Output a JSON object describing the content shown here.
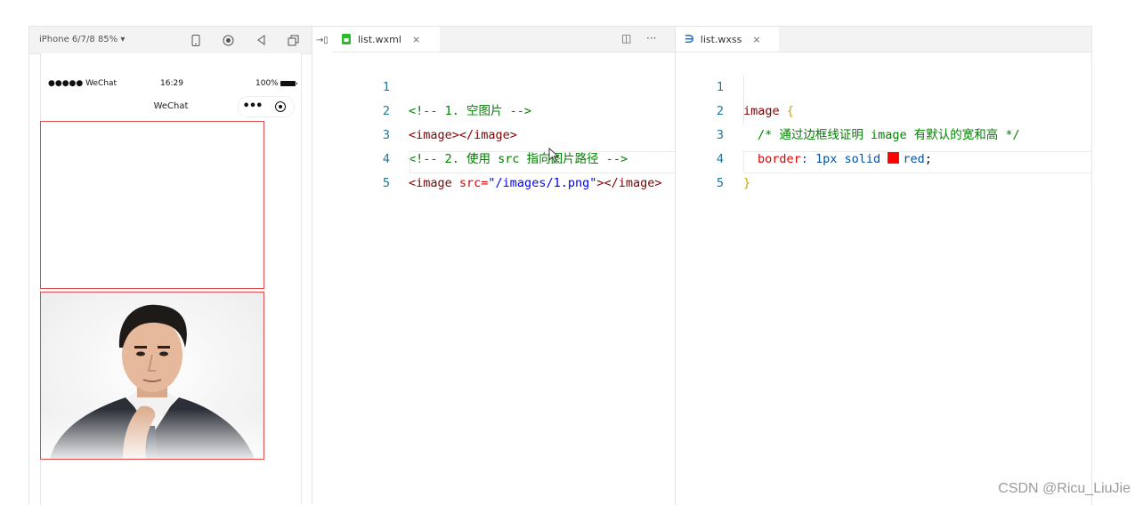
{
  "simulator": {
    "device": "iPhone 6/7/8 85% ▾",
    "status": {
      "carrier": "●●●●● WeChat",
      "time": "16:29",
      "battery": "100%"
    },
    "nav_title": "WeChat",
    "capsule_more": "•••",
    "images": [
      {
        "label": "empty image (no src)",
        "border_color": "#e04a4a"
      },
      {
        "label": "/images/1.png portrait",
        "border_color": "#e04a4a"
      }
    ]
  },
  "editor_left": {
    "tab": {
      "icon": "wxml-file-icon",
      "label": "list.wxml",
      "close": "×"
    },
    "actions": {
      "split": "◫",
      "more": "···"
    },
    "lines": [
      {
        "n": "1",
        "tokens": [
          "<!-- 1. 空图片 -->"
        ]
      },
      {
        "n": "2",
        "tokens": [
          "<image></image>"
        ]
      },
      {
        "n": "3",
        "tokens": [
          "<!-- 2. 使用 src 指向图片路径 -->"
        ]
      },
      {
        "n": "4",
        "tokens": [
          "<image",
          " src=",
          "\"/images/1.png\"",
          "></image>"
        ]
      },
      {
        "n": "5",
        "tokens": [
          ""
        ]
      }
    ]
  },
  "editor_right": {
    "tab": {
      "icon": "wxss-file-icon",
      "label": "list.wxss",
      "close": "×"
    },
    "lines": [
      {
        "n": "1",
        "tokens": [
          "image",
          " {"
        ]
      },
      {
        "n": "2",
        "tokens": [
          "/* 通过边框线证明 image 有默认的宽和高 */"
        ]
      },
      {
        "n": "3",
        "tokens": [
          "border",
          ": 1px solid ",
          "red",
          ";"
        ]
      },
      {
        "n": "4",
        "tokens": [
          "}"
        ]
      },
      {
        "n": "5",
        "tokens": [
          ""
        ]
      }
    ]
  },
  "watermark": "CSDN @Ricu_LiuJie",
  "colors": {
    "border_red": "#e04a4a",
    "comment": "#008000",
    "tag": "#800000",
    "attr": "#e50000",
    "string": "#0000ff",
    "line_number": "#237893"
  }
}
